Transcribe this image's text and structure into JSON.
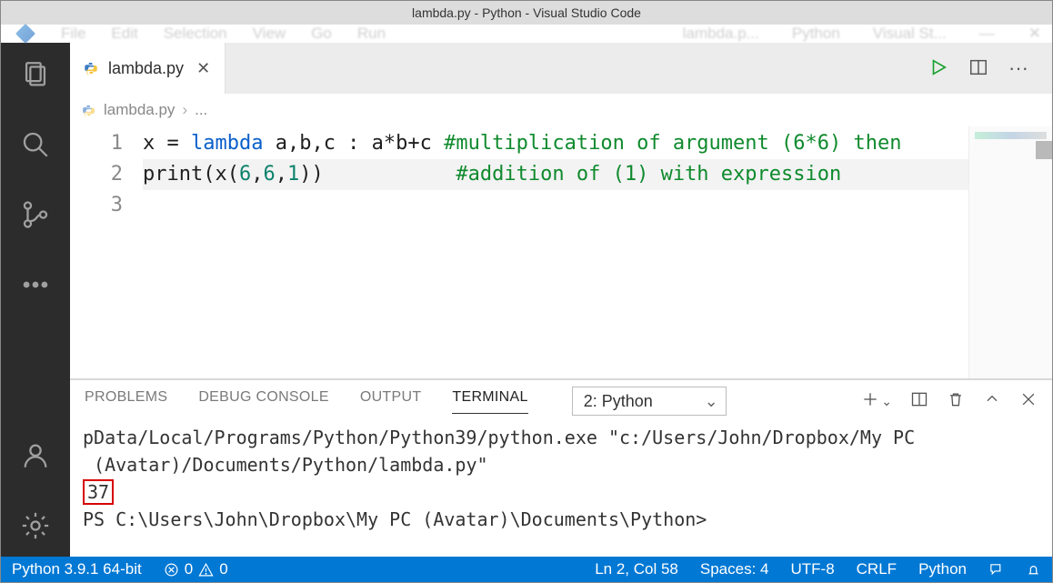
{
  "titlebar": {
    "text": "lambda.py - Python - Visual Studio Code"
  },
  "menubar": {
    "items": [
      "File",
      "Edit",
      "Selection",
      "View",
      "Go",
      "Run"
    ],
    "right": [
      "lambda.p...",
      "Python",
      "Visual St..."
    ]
  },
  "tab": {
    "filename": "lambda.py"
  },
  "breadcrumb": {
    "filename": "lambda.py",
    "sep": "›",
    "rest": "..."
  },
  "editor": {
    "line_numbers": [
      "1",
      "2",
      "3"
    ],
    "line1": {
      "a": "x = ",
      "kw": "lambda",
      "b": " a,b,c : a*b+c ",
      "cm": "#multiplication of argument (6*6) then"
    },
    "line2": {
      "a": "print(x(",
      "n1": "6",
      "c1": ",",
      "n2": "6",
      "c2": ",",
      "n3": "1",
      "b": "))           ",
      "cm": "#addition of (1) with expression"
    }
  },
  "panel": {
    "tabs": {
      "problems": "PROBLEMS",
      "debug": "DEBUG CONSOLE",
      "output": "OUTPUT",
      "terminal": "TERMINAL"
    },
    "select": "2: Python",
    "terminal": {
      "l1": "pData/Local/Programs/Python/Python39/python.exe \"c:/Users/John/Dropbox/My PC",
      "l2": " (Avatar)/Documents/Python/lambda.py\"",
      "out": "37",
      "prompt": "PS C:\\Users\\John\\Dropbox\\My PC (Avatar)\\Documents\\Python>"
    }
  },
  "status": {
    "python": "Python 3.9.1 64-bit",
    "err": "0",
    "warn": "0",
    "pos": "Ln 2, Col 58",
    "spaces": "Spaces: 4",
    "enc": "UTF-8",
    "eol": "CRLF",
    "lang": "Python"
  }
}
